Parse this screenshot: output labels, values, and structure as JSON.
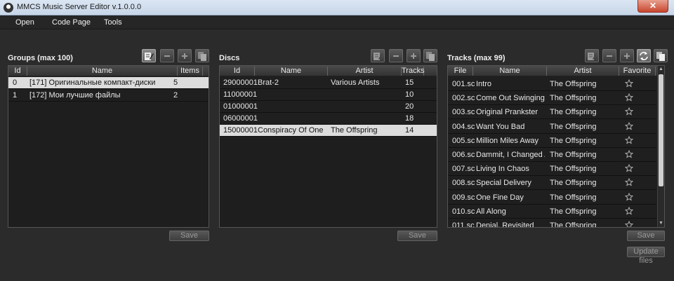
{
  "window": {
    "title": "MMCS Music Server Editor v.1.0.0.0",
    "close_glyph": "✕"
  },
  "menu": {
    "open": "Open",
    "code_page": "Code Page",
    "tools": "Tools"
  },
  "groups": {
    "title": "Groups (max 100)",
    "columns": {
      "id": "Id",
      "name": "Name",
      "items": "Items"
    },
    "rows": [
      {
        "id": "0",
        "name": "[171] Оригинальные компакт-диски",
        "items": "5"
      },
      {
        "id": "1",
        "name": "[172] Мои лучшие файлы",
        "items": "2"
      }
    ],
    "save": "Save"
  },
  "discs": {
    "title": "Discs",
    "columns": {
      "id": "Id",
      "name": "Name",
      "artist": "Artist",
      "tracks": "Tracks"
    },
    "rows": [
      {
        "id": "29000001",
        "name": "Brat-2",
        "artist": "Various Artists",
        "tracks": "15"
      },
      {
        "id": "11000001",
        "name": "",
        "artist": "",
        "tracks": "10"
      },
      {
        "id": "01000001",
        "name": "",
        "artist": "",
        "tracks": "20"
      },
      {
        "id": "06000001",
        "name": "",
        "artist": "",
        "tracks": "18"
      },
      {
        "id": "15000001",
        "name": "Conspiracy Of One",
        "artist": "The Offspring",
        "tracks": "14"
      }
    ],
    "save": "Save"
  },
  "tracks": {
    "title": "Tracks (max 99)",
    "columns": {
      "file": "File",
      "name": "Name",
      "artist": "Artist",
      "favorite": "Favorite"
    },
    "rows": [
      {
        "file": "001.sc",
        "name": "Intro",
        "artist": "The Offspring"
      },
      {
        "file": "002.sc",
        "name": "Come Out Swinging",
        "artist": "The Offspring"
      },
      {
        "file": "003.sc",
        "name": "Original Prankster",
        "artist": "The Offspring"
      },
      {
        "file": "004.sc",
        "name": "Want You Bad",
        "artist": "The Offspring"
      },
      {
        "file": "005.sc",
        "name": "Million Miles Away",
        "artist": "The Offspring"
      },
      {
        "file": "006.sc",
        "name": "Dammit, I Changed Agai",
        "artist": "The Offspring"
      },
      {
        "file": "007.sc",
        "name": "Living In Chaos",
        "artist": "The Offspring"
      },
      {
        "file": "008.sc",
        "name": "Special Delivery",
        "artist": "The Offspring"
      },
      {
        "file": "009.sc",
        "name": "One Fine Day",
        "artist": "The Offspring"
      },
      {
        "file": "010.sc",
        "name": "All Along",
        "artist": "The Offspring"
      },
      {
        "file": "011.sc",
        "name": "Denial, Revisited",
        "artist": "The Offspring"
      }
    ],
    "save": "Save",
    "update_files": "Update files"
  },
  "icons": {
    "edit": "edit-icon",
    "remove": "minus-icon",
    "add": "plus-icon",
    "copy": "copy-icon",
    "refresh": "refresh-icon",
    "favorite": "star-outline-icon"
  },
  "colors": {
    "background": "#2b2b2b",
    "grid": "#1e1e1e",
    "selected_row": "#dcdcdc"
  }
}
